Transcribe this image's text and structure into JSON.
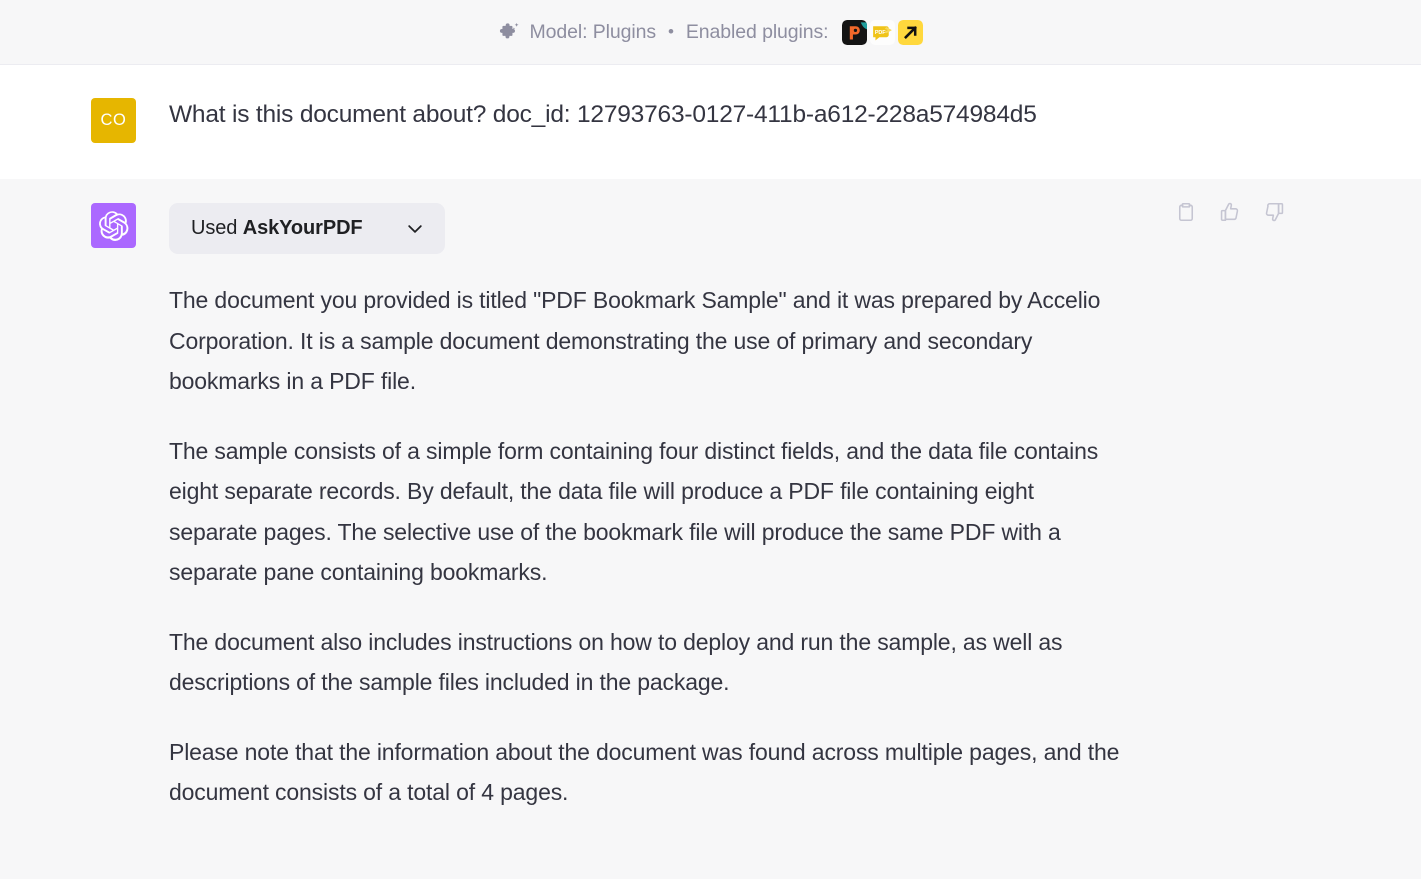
{
  "header": {
    "puzzle_icon": "puzzle-icon",
    "model_label": "Model: Plugins",
    "separator": "•",
    "enabled_label": "Enabled plugins:",
    "plugins": [
      {
        "name": "plugin-icon-prompt-perfect",
        "bg": "#1b1b1b",
        "accent": "#f2682a"
      },
      {
        "name": "plugin-icon-askyourpdf",
        "bg": "#ffffff",
        "accent": "#f5c518"
      },
      {
        "name": "plugin-icon-link-reader",
        "bg": "#ffd83d",
        "accent": "#111111"
      }
    ]
  },
  "user_message": {
    "avatar_initials": "CO",
    "avatar_color": "#e6b600",
    "text": "What is this document about? doc_id: 12793763-0127-411b-a612-228a574984d5"
  },
  "assistant_message": {
    "avatar_icon": "openai-logo-icon",
    "avatar_color": "#ab68ff",
    "plugin_pill": {
      "prefix": "Used",
      "plugin_name": "AskYourPDF",
      "chevron": "chevron-down-icon"
    },
    "paragraphs": [
      "The document you provided is titled \"PDF Bookmark Sample\" and it was prepared by Accelio Corporation. It is a sample document demonstrating the use of primary and secondary bookmarks in a PDF file.",
      "The sample consists of a simple form containing four distinct fields, and the data file contains eight separate records. By default, the data file will produce a PDF file containing eight separate pages. The selective use of the bookmark file will produce the same PDF with a separate pane containing bookmarks.",
      "The document also includes instructions on how to deploy and run the sample, as well as descriptions of the sample files included in the package.",
      "Please note that the information about the document was found across multiple pages, and the document consists of a total of 4 pages."
    ],
    "actions": [
      {
        "name": "copy-button",
        "icon": "clipboard-icon"
      },
      {
        "name": "thumbs-up-button",
        "icon": "thumbs-up-icon"
      },
      {
        "name": "thumbs-down-button",
        "icon": "thumbs-down-icon"
      }
    ]
  }
}
